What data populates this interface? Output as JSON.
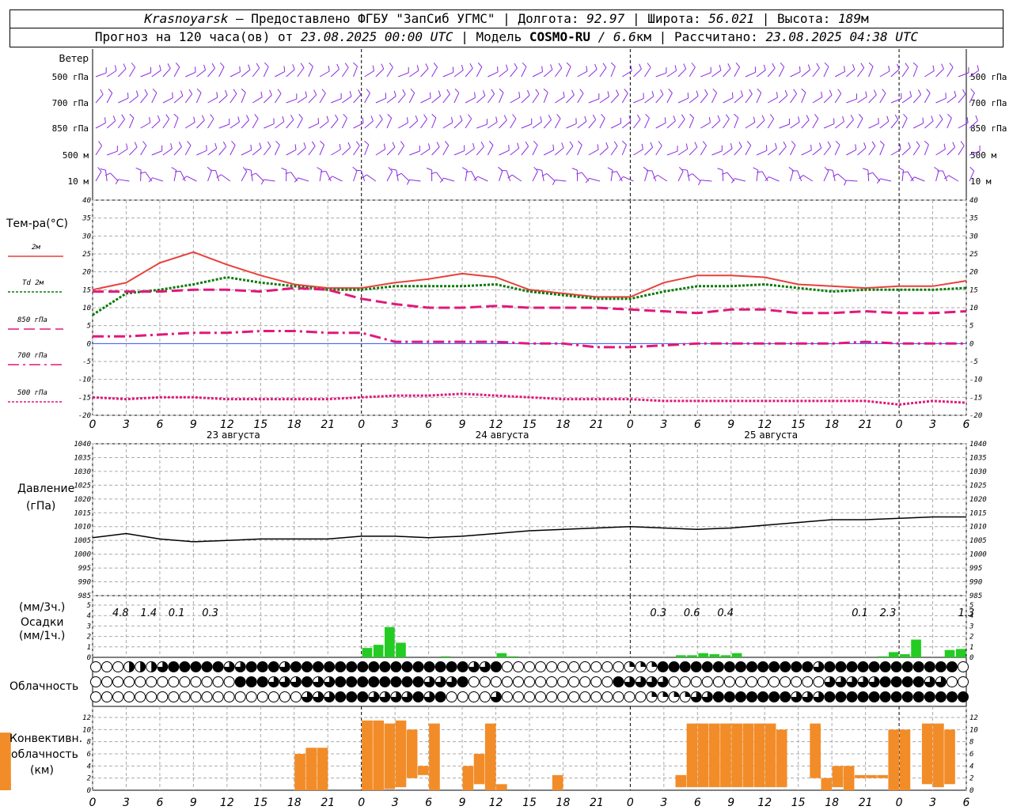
{
  "header": {
    "city": "Krasnoyarsk",
    "dash": " — ",
    "provider": "Предоставлено ФГБУ \"ЗапСиб УГМС\"",
    "sep": " | ",
    "lon_label": "Долгота: ",
    "lon": "92.97",
    "lat_label": "Широта: ",
    "lat": "56.021",
    "alt_label": "Высота: ",
    "alt": "189",
    "alt_unit": "м",
    "forecast_label": "Прогноз на 120 часа(ов) от ",
    "forecast_time": "23.08.2025 00:00 UTC",
    "model_label": "Модель ",
    "model": "COSMO-RU",
    "model_res": " / 6.6",
    "model_res_unit": "км",
    "calc_label": "Рассчитано: ",
    "calc_time": "23.08.2025 04:38 UTC"
  },
  "axis": {
    "hour_ticks": [
      "0",
      "3",
      "6",
      "9",
      "12",
      "15",
      "18",
      "21",
      "0",
      "3",
      "6",
      "9",
      "12",
      "15",
      "18",
      "21",
      "0",
      "3",
      "6",
      "9",
      "12",
      "15",
      "18",
      "21",
      "0",
      "3",
      "6"
    ],
    "days": [
      "23 августа",
      "24 августа",
      "25 августа"
    ]
  },
  "wind": {
    "title": "Ветер",
    "levels": [
      "500 гПа",
      "700 гПа",
      "850 гПа",
      "500  м",
      "10   м"
    ]
  },
  "temp": {
    "title": "Тем-ра(°С)",
    "legend": [
      "2м",
      "Td  2м",
      "850 гПа",
      "700 гПа",
      "500 гПа"
    ],
    "ticks": [
      "40",
      "35",
      "30",
      "25",
      "20",
      "15",
      "10",
      "5",
      "0",
      "-5",
      "-10",
      "-15",
      "-20"
    ]
  },
  "pressure": {
    "title": "Давление",
    "unit": "(гПа)",
    "ticks": [
      "1040",
      "1035",
      "1030",
      "1025",
      "1020",
      "1015",
      "1010",
      "1005",
      "1000",
      "995",
      "990",
      "985"
    ]
  },
  "precip": {
    "unit3": "(мм/3ч.)",
    "title": "Осадки",
    "unit1": "(мм/1ч.)",
    "ticks": [
      "5",
      "4",
      "3",
      "2",
      "1",
      "0"
    ],
    "totals": [
      "4.8",
      "1.4",
      "0.1",
      "0.3",
      "0.3",
      "0.6",
      "0.4",
      "0.1",
      "2.3",
      "1.3"
    ]
  },
  "clouds": {
    "title": "Облачность"
  },
  "conv": {
    "title1": "Конвективн.",
    "title2": "облачность",
    "unit": "(км)",
    "ticks": [
      "12",
      "10",
      "8",
      "6",
      "4",
      "2",
      "0"
    ]
  },
  "colors": {
    "wind": "#8a2be2",
    "t2m": "#e8403a",
    "td": "#0a7a0a",
    "t850": "#e0197a",
    "t700": "#e0197a",
    "t500": "#e0197a",
    "precip": "#22cc22",
    "conv": "#f28c28"
  },
  "chart_data": [
    {
      "type": "line",
      "name": "temperature",
      "ylim": [
        -20,
        40
      ],
      "x_hours": [
        0,
        3,
        6,
        9,
        12,
        15,
        18,
        21,
        24,
        27,
        30,
        33,
        36,
        39,
        42,
        45,
        48,
        51,
        54,
        57,
        60,
        63,
        66,
        69,
        72,
        75,
        78
      ],
      "series": [
        {
          "name": "2м",
          "values": [
            15,
            17,
            22.5,
            25.5,
            22,
            19,
            16.5,
            15.5,
            15.5,
            17,
            18,
            19.5,
            18.5,
            15,
            14,
            13,
            13,
            17,
            19,
            19,
            18.5,
            16.5,
            16,
            15.5,
            16,
            16,
            17.5
          ]
        },
        {
          "name": "Td  2м",
          "values": [
            8,
            14,
            15,
            16.5,
            18.5,
            17,
            16,
            15,
            15,
            16,
            16,
            16,
            16.5,
            14.5,
            13.5,
            12.5,
            12.5,
            14.5,
            16,
            16,
            16.5,
            15.5,
            14.5,
            15,
            15,
            15,
            15.5
          ]
        },
        {
          "name": "850 гПа",
          "values": [
            14.5,
            14.5,
            14.5,
            15,
            15,
            14.5,
            15.5,
            15,
            12.5,
            11,
            10,
            10,
            10.5,
            10,
            10,
            10,
            9.5,
            9,
            8.5,
            9.5,
            9.5,
            8.5,
            8.5,
            9,
            8.5,
            8.5,
            9
          ]
        },
        {
          "name": "700 гПа",
          "values": [
            2,
            2,
            2.5,
            3,
            3,
            3.5,
            3.5,
            3,
            3,
            0.5,
            0.5,
            0.5,
            0.5,
            0,
            0,
            -1,
            -1,
            -0.5,
            0,
            0,
            0,
            0,
            0,
            0.5,
            0,
            0,
            0
          ]
        },
        {
          "name": "500 гПа",
          "values": [
            -15,
            -15.5,
            -15,
            -15,
            -15.5,
            -15.5,
            -15.5,
            -15.5,
            -15,
            -14.5,
            -14.5,
            -14,
            -14.5,
            -15,
            -15.5,
            -15.5,
            -15.5,
            -16,
            -16,
            -16,
            -16,
            -16,
            -16,
            -16,
            -17,
            -16,
            -16.5
          ]
        }
      ]
    },
    {
      "type": "line",
      "name": "pressure",
      "ylim": [
        985,
        1040
      ],
      "x_hours": [
        0,
        3,
        6,
        9,
        12,
        15,
        18,
        21,
        24,
        27,
        30,
        33,
        36,
        39,
        42,
        45,
        48,
        51,
        54,
        57,
        60,
        63,
        66,
        69,
        72,
        75,
        78
      ],
      "values": [
        1006,
        1007.5,
        1005.5,
        1004.5,
        1005,
        1005.5,
        1005.5,
        1005.5,
        1006.5,
        1006.5,
        1006,
        1006.5,
        1007.5,
        1008.5,
        1009,
        1009.5,
        1010,
        1009.5,
        1009,
        1009.5,
        1010.5,
        1011.5,
        1012.5,
        1012.5,
        1013,
        1013.5,
        1013.5
      ]
    },
    {
      "type": "bar",
      "name": "precipitation",
      "ylim": [
        0,
        5
      ],
      "x_hours": [
        0,
        1,
        2,
        3,
        4,
        5,
        6,
        7,
        8,
        9,
        10,
        11,
        12,
        13,
        14,
        15,
        16,
        17,
        18,
        19,
        20,
        21,
        22,
        23,
        24,
        25,
        26,
        27,
        28,
        29,
        30,
        31,
        32,
        33,
        34,
        35,
        36,
        37,
        38,
        39,
        40,
        41,
        42,
        43,
        44,
        45,
        46,
        47,
        48,
        49,
        50,
        51,
        52,
        53,
        54,
        55,
        56,
        57,
        58,
        59,
        60,
        61,
        62,
        63,
        64,
        65,
        66,
        67,
        68,
        69,
        70,
        71,
        72,
        73,
        74,
        75,
        76,
        77
      ],
      "values": [
        0,
        0,
        0,
        0,
        0,
        0,
        0,
        0,
        0,
        0,
        0,
        0,
        0,
        0,
        0,
        0,
        0,
        0,
        0,
        0,
        0,
        0,
        0,
        0,
        0.9,
        1.2,
        2.9,
        1.4,
        0,
        0,
        0,
        0.1,
        0,
        0,
        0,
        0,
        0.4,
        0.1,
        0,
        0,
        0,
        0,
        0,
        0,
        0,
        0,
        0,
        0,
        0,
        0,
        0,
        0,
        0.2,
        0.2,
        0.4,
        0.3,
        0.2,
        0.4,
        0,
        0,
        0,
        0,
        0,
        0,
        0,
        0,
        0,
        0,
        0,
        0,
        0.1,
        0.5,
        0.3,
        1.7,
        0,
        0,
        0.7,
        0.8
      ]
    },
    {
      "type": "bar",
      "name": "convective_clouds",
      "ylim": [
        0,
        12
      ],
      "x_hours": [
        0,
        1,
        2,
        3,
        4,
        5,
        6,
        7,
        8,
        9,
        10,
        11,
        12,
        13,
        14,
        15,
        16,
        17,
        18,
        19,
        20,
        21,
        22,
        23,
        24,
        25,
        26,
        27,
        28,
        29,
        30,
        31,
        32,
        33,
        34,
        35,
        36,
        37,
        38,
        39,
        40,
        41,
        42,
        43,
        44,
        45,
        46,
        47,
        48,
        49,
        50,
        51,
        52,
        53,
        54,
        55,
        56,
        57,
        58,
        59,
        60,
        61,
        62,
        63,
        64,
        65,
        66,
        67,
        68,
        69,
        70,
        71,
        72,
        73,
        74,
        75,
        76,
        77
      ],
      "bottom": [
        0,
        0,
        0,
        0,
        0,
        0,
        0,
        0,
        0,
        0,
        0,
        0,
        0,
        0,
        0,
        0,
        0,
        0,
        0,
        0,
        0,
        0,
        0,
        0,
        0,
        0,
        0.2,
        0.5,
        2,
        2.5,
        0,
        0,
        0,
        0,
        1,
        0,
        0,
        0,
        0,
        0,
        0,
        0,
        0,
        0,
        0,
        0,
        0,
        0,
        0,
        0,
        0,
        0,
        0.5,
        0.5,
        0.5,
        0.5,
        0.5,
        0.5,
        0.5,
        0.5,
        0.5,
        0.5,
        0,
        0,
        2,
        0,
        0.5,
        0,
        2,
        2,
        2,
        0,
        0,
        0,
        1,
        0.5,
        1,
        1.5,
        0
      ],
      "top": [
        0,
        0,
        0,
        0,
        0,
        0,
        0,
        0,
        0,
        0,
        0,
        0,
        0,
        0,
        0,
        0,
        0,
        0,
        6,
        7,
        7,
        0,
        0,
        0,
        11.5,
        11.5,
        11,
        11.5,
        10,
        4,
        11,
        0,
        0,
        4,
        6,
        11,
        1,
        0,
        0,
        0,
        0,
        2.5,
        0,
        0,
        0,
        0,
        0,
        0,
        0,
        0,
        0,
        0,
        2.5,
        11,
        11,
        11,
        11,
        11,
        11,
        11,
        11,
        10,
        0,
        0,
        11,
        2,
        4,
        4,
        2.5,
        2.5,
        2.5,
        10,
        10,
        0,
        11,
        11,
        10,
        0,
        1.5,
        2.5,
        8,
        9.5
      ]
    }
  ]
}
